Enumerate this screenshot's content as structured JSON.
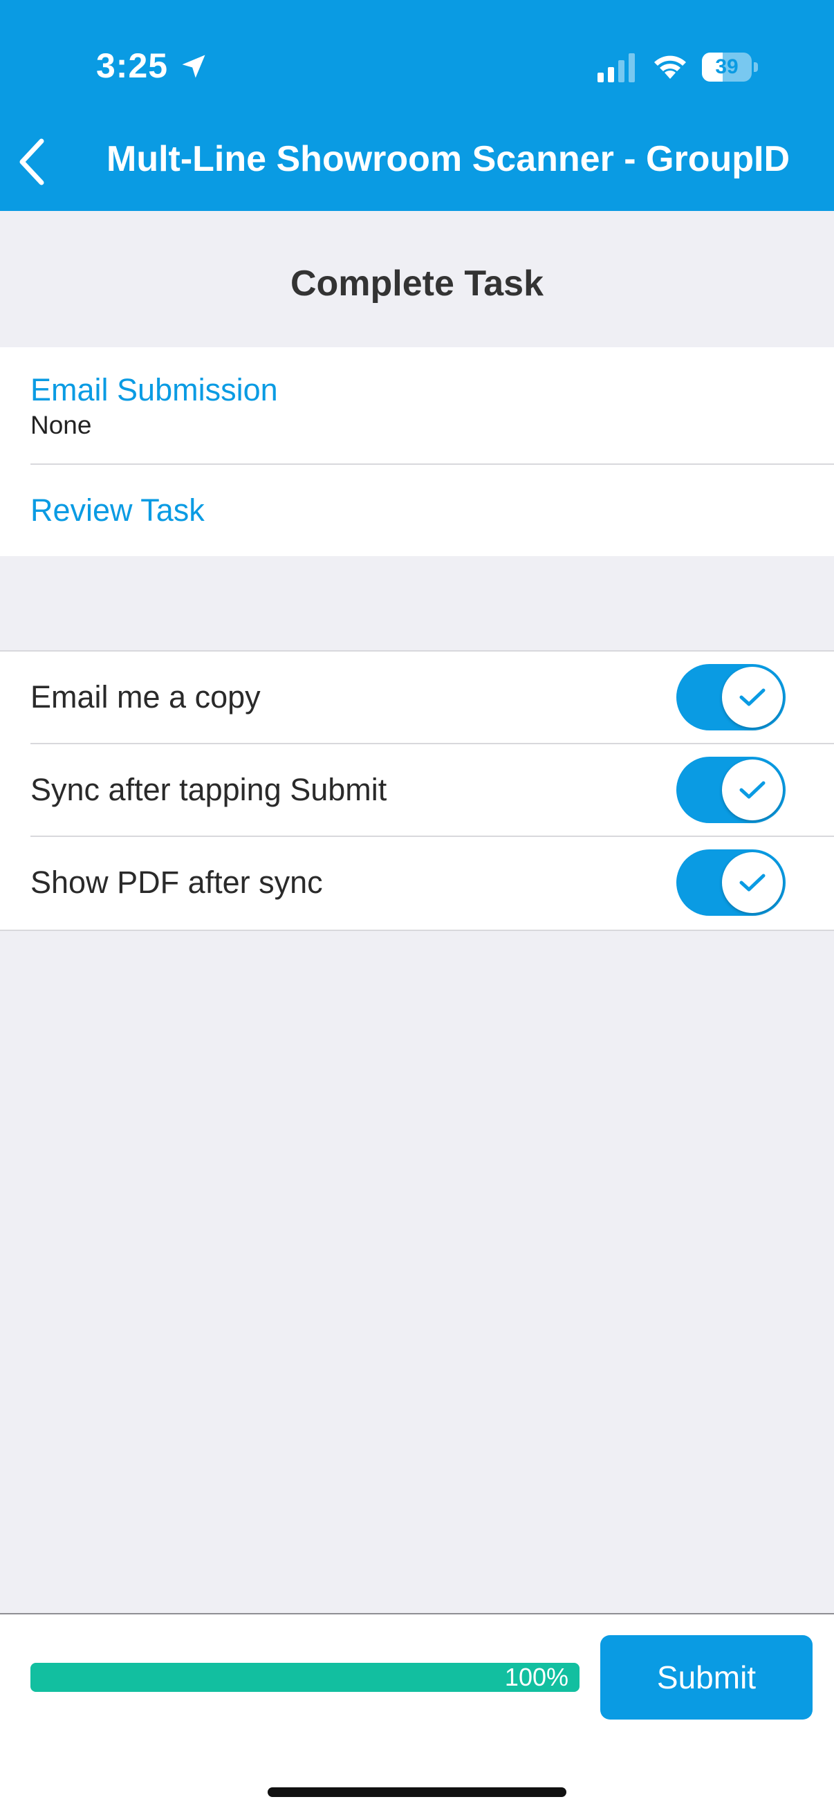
{
  "status_bar": {
    "time": "3:25",
    "battery": "39",
    "location_icon": "location-arrow-icon",
    "signal_icon": "cellular-signal-icon",
    "wifi_icon": "wifi-icon"
  },
  "nav": {
    "title": "Mult-Line Showroom Scanner - GroupID",
    "back_icon": "chevron-left-icon"
  },
  "section_title": "Complete Task",
  "email_submission": {
    "label": "Email Submission",
    "value": "None"
  },
  "review_task": {
    "label": "Review Task"
  },
  "toggles": [
    {
      "label": "Email me a copy",
      "on": true
    },
    {
      "label": "Sync after tapping Submit",
      "on": true
    },
    {
      "label": "Show PDF after sync",
      "on": true
    }
  ],
  "footer": {
    "progress_percent": 100,
    "progress_text": "100%",
    "submit_label": "Submit"
  },
  "colors": {
    "brand": "#0a9be3",
    "progress": "#12bfa0",
    "background": "#efeff4"
  }
}
